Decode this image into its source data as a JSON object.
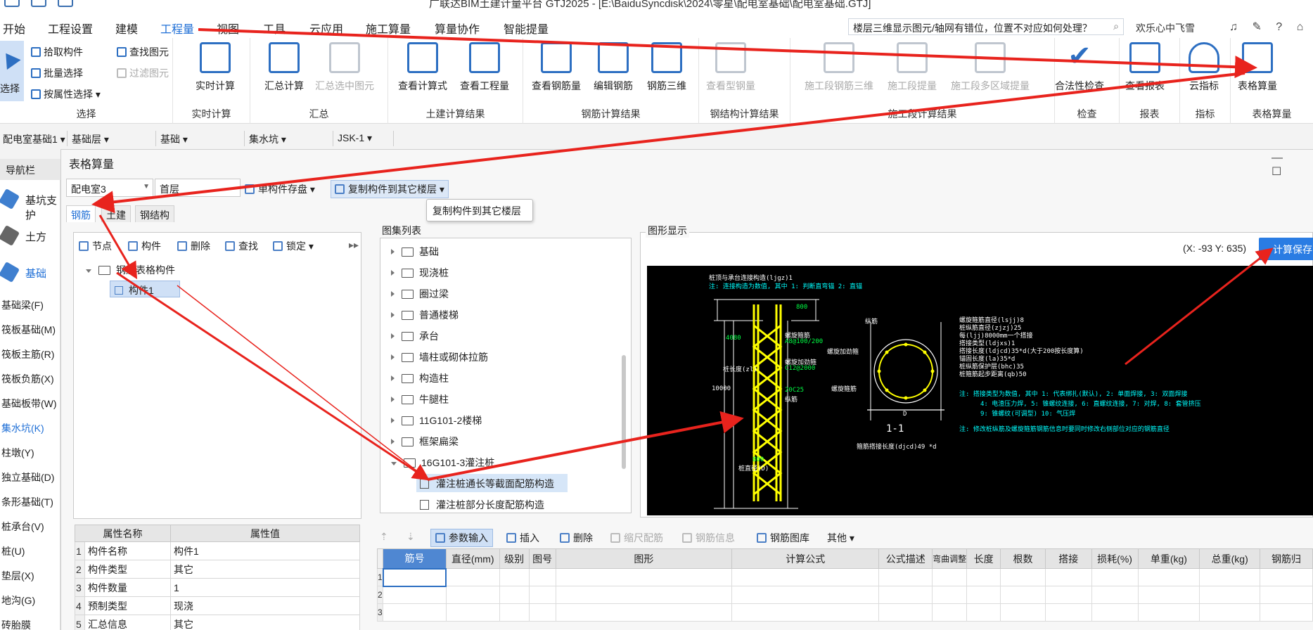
{
  "window": {
    "title": "广联达BIM土建计量平台 GTJ2025 - [E:\\BaiduSyncdisk\\2024\\零星\\配电室基础\\配电室基础.GTJ]"
  },
  "menu": {
    "items": [
      "开始",
      "工程设置",
      "建模",
      "工程量",
      "视图",
      "工具",
      "云应用",
      "施工算量",
      "算量协作",
      "智能提量"
    ],
    "active": "工程量",
    "search_value": "楼层三维显示图元/轴网有错位，位置不对应如何处理？",
    "user": "欢乐心中飞雪",
    "right_icons": "♫ ✎ ? ⌂"
  },
  "ribbon": {
    "select_group": {
      "label": "选择",
      "select_btn": "选择",
      "pick": "拾取构件",
      "batch": "批量选择",
      "by_attr": "按属性选择",
      "find": "查找图元",
      "filter": "过滤图元"
    },
    "realtime": {
      "label": "实时计算",
      "btn": "实时计算"
    },
    "summary": {
      "label": "汇总",
      "btn1": "汇总计算",
      "btn2": "汇总选中图元"
    },
    "civil": {
      "label": "土建计算结果",
      "btn1": "查看计算式",
      "btn2": "查看工程量"
    },
    "rebar": {
      "label": "钢筋计算结果",
      "btn1": "查看钢筋量",
      "btn2": "编辑钢筋",
      "btn3": "钢筋三维"
    },
    "steel": {
      "label": "钢结构计算结果",
      "btn1": "查看型钢量"
    },
    "stage": {
      "label": "施工段计算结果",
      "btn1": "施工段钢筋三维",
      "btn2": "施工段提量",
      "btn3": "施工段多区域提量"
    },
    "check": {
      "label": "检查",
      "btn": "合法性检查"
    },
    "report": {
      "label": "报表",
      "btn": "查看报表"
    },
    "index": {
      "label": "指标",
      "btn": "云指标"
    },
    "table": {
      "label": "表格算量",
      "btn": "表格算量"
    }
  },
  "context_bar": [
    "配电室基础1",
    "基础层",
    "基础",
    "集水坑",
    "JSK-1"
  ],
  "left_nav": {
    "title": "导航栏",
    "big_items": [
      "基坑支护",
      "土方",
      "基础"
    ],
    "items": [
      "基础梁(F)",
      "筏板基础(M)",
      "筏板主筋(R)",
      "筏板负筋(X)",
      "基础板带(W)",
      "集水坑(K)",
      "柱墩(Y)",
      "独立基础(D)",
      "条形基础(T)",
      "桩承台(V)",
      "桩(U)",
      "垫层(X)",
      "地沟(G)",
      "砖胎膜"
    ],
    "active": "集水坑(K)"
  },
  "dialog": {
    "title": "表格算量",
    "winbtns": "— ☐",
    "floor_group": "配电室3",
    "floor": "首层",
    "btn_save_comp": "单构件存盘",
    "btn_copy": "复制构件到其它楼层",
    "tooltip": "复制构件到其它楼层",
    "tabs": [
      "钢筋",
      "土建",
      "钢结构"
    ],
    "left_toolbar": [
      "节点",
      "构件",
      "删除",
      "查找",
      "锁定"
    ],
    "tree_root": "钢筋表格构件",
    "tree_child": "构件1",
    "prop_headers": [
      "属性名称",
      "属性值"
    ],
    "props": [
      {
        "n": "1",
        "name": "构件名称",
        "value": "构件1"
      },
      {
        "n": "2",
        "name": "构件类型",
        "value": "其它"
      },
      {
        "n": "3",
        "name": "构件数量",
        "value": "1"
      },
      {
        "n": "4",
        "name": "预制类型",
        "value": "现浇"
      },
      {
        "n": "5",
        "name": "汇总信息",
        "value": "其它"
      }
    ],
    "atlas_caption": "图集列表",
    "atlas": [
      "基础",
      "现浇桩",
      "圈过梁",
      "普通楼梯",
      "承台",
      "墙柱或砌体拉筋",
      "构造柱",
      "牛腿柱",
      "11G101-2楼梯",
      "框架扁梁",
      "16G101-3灌注桩"
    ],
    "atlas_children": [
      "灌注桩通长等截面配筋构造",
      "灌注桩部分长度配筋构造"
    ],
    "graph_caption": "图形显示",
    "coords": "(X: -93 Y: 635)",
    "calc_save": "计算保存",
    "cad_left": {
      "t1": "桩顶与承台连接构造(ljgz)1",
      "t2": "注: 连接构造为数值, 其中 1: 判断直弯锚      2: 直锚",
      "d1": "800",
      "d2": "4080",
      "d3": "10000",
      "len": "桩长度(zl)",
      "sp1": "螺旋箍筋",
      "sp1v": "A8@100/200",
      "sp2": "螺旋加劲箍",
      "sp2v": "C12@2000",
      "sp3": "20C25",
      "sp4": "纵筋",
      "dia": "800",
      "diam": "桩直径(D)"
    },
    "cad_mid": {
      "a": "纵筋",
      "b": "螺旋加劲箍",
      "c": "螺旋箍筋",
      "d": "D",
      "sec": "1-1",
      "lap": "箍筋搭接长度(djcd)49    *d"
    },
    "cad_right": {
      "r1": "螺旋箍筋直径(lsjj)8",
      "r2": "桩纵筋直径(zjzj)25",
      "r3": "每(ljj)8000mm一个搭接",
      "r4": "搭接类型(ldjxs)1",
      "r5": "搭接长度(ldjcd)35*d(大于200按长度算)",
      "r6": "锚固长度(la)35*d",
      "r7": "桩纵筋保护层(bhc)35",
      "r8": "桩箍筋起步距离(qb)50",
      "n1": "注: 搭接类型为数值, 其中 1: 代表绑扎(默认), 2: 单面焊接, 3: 双面焊接",
      "n2": "4: 电渣压力焊, 5: 锥螺纹连接, 6: 直螺纹连接, 7: 对焊, 8: 套管挤压",
      "n3": "9: 锥螺纹(可调型) 10: 气压焊",
      "n4": "注: 修改桩纵筋及螺旋箍筋钢筋信息时要同时修改右侧部位对应的钢筋直径"
    },
    "grid_toolbar": [
      "参数输入",
      "插入",
      "删除",
      "缩尺配筋",
      "钢筋信息",
      "钢筋图库",
      "其他"
    ],
    "grid_headers": [
      "筋号",
      "直径(mm)",
      "级别",
      "图号",
      "图形",
      "计算公式",
      "公式描述",
      "弯曲调整",
      "长度",
      "根数",
      "搭接",
      "损耗(%)",
      "单重(kg)",
      "总重(kg)",
      "钢筋归"
    ],
    "grid_rows": [
      "1",
      "2",
      "3"
    ]
  },
  "colors": {
    "accent": "#1f6fd6",
    "arrow": "#e8231d",
    "cad_yellow": "#ffff00",
    "cad_green": "#00ff44",
    "cad_cyan": "#00ffff"
  }
}
